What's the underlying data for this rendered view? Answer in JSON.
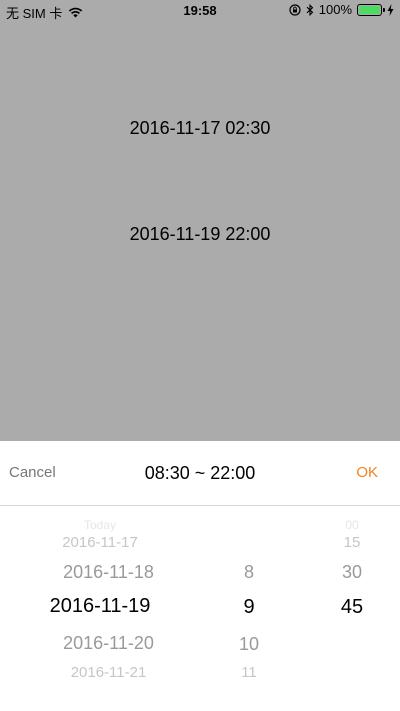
{
  "status_bar": {
    "carrier": "无 SIM 卡",
    "time": "19:58",
    "battery_percent": "100%",
    "battery_level": 1.0,
    "wifi_icon": "wifi-icon",
    "lock_icon": "orientation-lock-icon",
    "bluetooth_icon": "bluetooth-icon",
    "charging_icon": "charging-bolt-icon",
    "battery_color": "#4cd964"
  },
  "main": {
    "start_label": "2016-11-17 02:30",
    "end_label": "2016-11-19 22:00",
    "background_color": "#ababab"
  },
  "toolbar": {
    "cancel_label": "Cancel",
    "title": "08:30 ~ 22:00",
    "ok_label": "OK",
    "ok_color": "#f5821f"
  },
  "picker": {
    "dates": [
      "Today",
      "2016-11-17",
      "2016-11-18",
      "2016-11-19",
      "2016-11-20",
      "2016-11-21"
    ],
    "selected_date": "2016-11-19",
    "hours": [
      "8",
      "9",
      "10",
      "11"
    ],
    "selected_hour": "9",
    "minutes": [
      "00",
      "15",
      "30",
      "45"
    ],
    "selected_minute": "45"
  }
}
